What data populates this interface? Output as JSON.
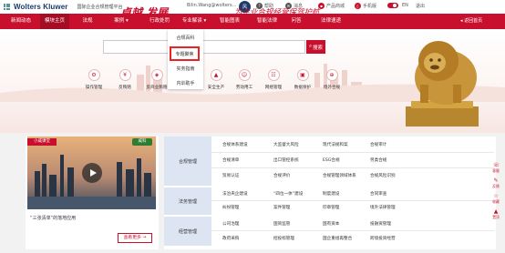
{
  "topbar": {
    "brand": "Wolters Kluwer",
    "platform": "国际企业合规管理平台",
    "user": "Bilin.Wang@wolters...",
    "avatar": "风",
    "links": [
      {
        "label": "帮助",
        "icon": "help-icon"
      },
      {
        "label": "消息",
        "icon": "message-icon"
      },
      {
        "label": "产品商城",
        "icon": "shop-icon"
      },
      {
        "label": "手机版",
        "icon": "mobile-icon"
      }
    ],
    "lang": "EN",
    "logout": "退出"
  },
  "nav": {
    "items": [
      "新闻动态",
      "模块主页",
      "法规",
      "案例",
      "行政处罚",
      "专业解读",
      "智能图表",
      "智能法律",
      "问答",
      "法律速递"
    ],
    "back": "返回首页"
  },
  "dropdown": {
    "items": [
      "合规百科",
      "专题聚焦",
      "实务指南",
      "内训助手"
    ]
  },
  "banner": {
    "slogan": "卓越 发展",
    "slogan2": "为企业合规经营保驾护航",
    "search_button": "搜索",
    "search_placeholder": ""
  },
  "quick_links": [
    {
      "label": "操作管理",
      "icon": "gear-icon"
    },
    {
      "label": "反贿赂",
      "icon": "coin-icon"
    },
    {
      "label": "反商业贿赂",
      "icon": "shield-icon"
    },
    {
      "label": "进出口环保",
      "icon": "globe-icon"
    },
    {
      "label": "安全生产",
      "icon": "helmet-icon"
    },
    {
      "label": "劳动用工",
      "icon": "worker-icon"
    },
    {
      "label": "网络管理",
      "icon": "network-icon"
    },
    {
      "label": "数据保护",
      "icon": "data-icon"
    },
    {
      "label": "境外合规",
      "icon": "world-icon"
    }
  ],
  "video_card": {
    "tag": "小威课堂",
    "tag2": "威科",
    "title": "“三张清单”的落地应用",
    "more": "查看更多 →"
  },
  "categories": [
    {
      "name": "合规管理",
      "rows": [
        [
          "合规体系建设",
          "大监督大风险",
          "现代法规和案",
          "合规审计"
        ],
        [
          "合规清单",
          "出口管控系统",
          "ESG合规",
          "另类合规"
        ],
        [
          "贸易认证",
          "合规评价",
          "合规管理领域体系",
          "合规风险识别"
        ]
      ]
    },
    {
      "name": "法务管理",
      "rows": [
        [
          "法治央企建设",
          "“四位一体”建设",
          "制度建设",
          "合同审查"
        ],
        [
          "纠纷管理",
          "案件管理",
          "印章管理",
          "境外法律管理"
        ]
      ]
    },
    {
      "name": "经营管理",
      "rows": [
        [
          "公司治理",
          "国资监管",
          "国有资本",
          "投融资管理"
        ],
        [
          "政府采购",
          "招投标管理",
          "国企重组再整合",
          "跨境投资经营"
        ]
      ]
    }
  ],
  "side_tools": [
    "客服",
    "反馈",
    "收藏",
    "置顶"
  ],
  "colors": {
    "brand_red": "#c8102e",
    "category_bg": "#dde5f2"
  }
}
